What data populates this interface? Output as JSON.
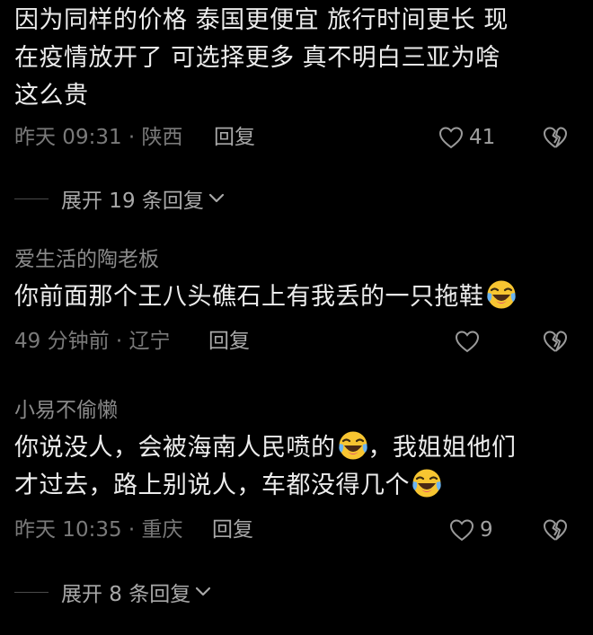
{
  "comments": [
    {
      "content_lines": [
        "因为同样的价格  泰国更便宜  旅行时间更长  现",
        "在疫情放开了    可选择更多  真不明白三亚为啥",
        "这么贵"
      ],
      "time_location": "昨天 09:31 · 陕西",
      "reply_label": "回复",
      "like_count": "41"
    },
    {
      "username": "爱生活的陶老板",
      "content_lines": [
        "你前面那个王八头礁石上有我丢的一只拖鞋"
      ],
      "time_location": "49 分钟前 · 辽宁",
      "reply_label": "回复",
      "like_count": ""
    },
    {
      "username": "小易不偷懒",
      "content_lines": [
        "你说没人，会被海南人民喷的",
        "，我姐姐他们",
        "才过去，路上别说人，车都没得几个"
      ],
      "time_location": "昨天 10:35 · 重庆",
      "reply_label": "回复",
      "like_count": "9"
    }
  ],
  "expand_replies": [
    {
      "label": "展开 19 条回复"
    },
    {
      "label": "展开 8 条回复"
    }
  ],
  "icons": {
    "like": "heart-outline-icon",
    "dislike": "broken-heart-icon",
    "expand": "chevron-down-icon",
    "emoji": "laughing-crying-emoji-icon"
  },
  "colors": {
    "background": "#000000",
    "text": "#ececec",
    "muted": "#7a7a7a",
    "emoji": "#f7c531"
  }
}
